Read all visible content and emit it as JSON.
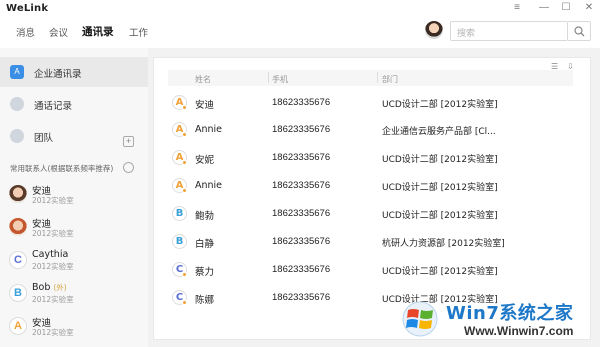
{
  "window": {
    "app_name": "WeLink",
    "controls": [
      "≡",
      "—",
      "☐",
      "✕"
    ]
  },
  "nav": {
    "tabs": [
      "消息",
      "会议",
      "通讯录",
      "工作"
    ],
    "active_tab": "通讯录",
    "search_placeholder": "搜索"
  },
  "sidebar": {
    "items": [
      {
        "label": "企业通讯录",
        "icon": "contacts-book-icon"
      },
      {
        "label": "通话记录",
        "icon": "phone-icon"
      },
      {
        "label": "团队",
        "icon": "team-icon"
      }
    ],
    "add_label": "+",
    "frequent_title": "常用联系人(根据联系频率推荐)",
    "contacts": [
      {
        "name": "安迪",
        "sub": "2012实验室",
        "badge": ""
      },
      {
        "name": "安迪",
        "sub": "2012实验室",
        "badge": ""
      },
      {
        "name": "Caythia",
        "sub": "2012实验室",
        "badge": ""
      },
      {
        "name": "Bob",
        "sub": "2012实验室",
        "badge": "(外)"
      },
      {
        "name": "安迪",
        "sub": "2012实验室",
        "badge": ""
      }
    ]
  },
  "table": {
    "headers": {
      "name": "姓名",
      "phone": "手机",
      "dept": "部门"
    },
    "rows": [
      {
        "avatar_letter": "A",
        "name": "安迪",
        "phone": "18623335676",
        "dept": "UCD设计二部 [2012实验室]"
      },
      {
        "avatar_letter": "A",
        "name": "Annie",
        "phone": "18623335676",
        "dept": "企业通信云服务产品部 [Cl..."
      },
      {
        "avatar_letter": "A",
        "name": "安妮",
        "phone": "18623335676",
        "dept": "UCD设计二部 [2012实验室]"
      },
      {
        "avatar_letter": "A",
        "name": "Annie",
        "phone": "18623335676",
        "dept": "UCD设计二部 [2012实验室]"
      },
      {
        "avatar_letter": "B",
        "name": "鲍勃",
        "phone": "18623335676",
        "dept": "UCD设计二部 [2012实验室]"
      },
      {
        "avatar_letter": "B",
        "name": "白静",
        "phone": "18623335676",
        "dept": "杭研人力资源部 [2012实验室]"
      },
      {
        "avatar_letter": "C",
        "name": "蔡力",
        "phone": "18623335676",
        "dept": "UCD设计二部 [2012实验室]"
      },
      {
        "avatar_letter": "C",
        "name": "陈娜",
        "phone": "18623335676",
        "dept": "UCD设计二部 [2012实验室]"
      }
    ]
  },
  "watermark": {
    "title": "Win7系统之家",
    "url": "Www.Winwin7.com"
  },
  "colors": {
    "accent_blue": "#1e78c8",
    "orange": "#f0a23a",
    "sidebar_bg": "#f7f7f7"
  }
}
